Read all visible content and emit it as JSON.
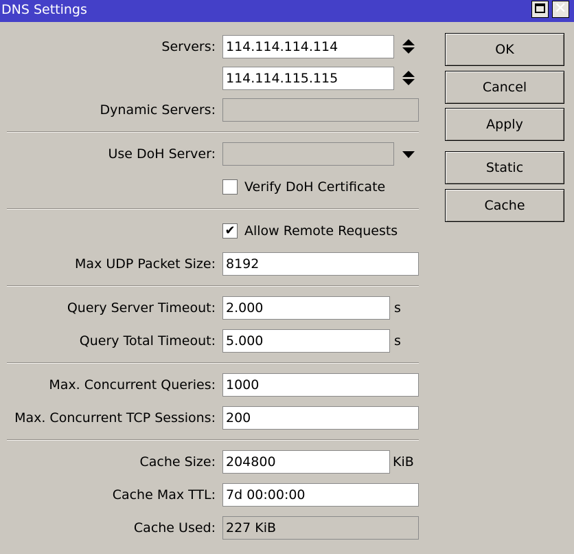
{
  "window": {
    "title": "DNS Settings"
  },
  "servers": {
    "label": "Servers:",
    "values": [
      "114.114.114.114",
      "114.114.115.115"
    ]
  },
  "dynamic_servers": {
    "label": "Dynamic Servers:",
    "value": ""
  },
  "doh": {
    "server_label": "Use DoH Server:",
    "server_value": "",
    "verify_label": "Verify DoH Certificate",
    "verify_checked": false
  },
  "remote": {
    "label": "Allow Remote Requests",
    "checked": true,
    "check_glyph": "✔"
  },
  "udp": {
    "label": "Max UDP Packet Size:",
    "value": "8192"
  },
  "timeouts": {
    "server_label": "Query Server Timeout:",
    "server_value": "2.000",
    "server_unit": "s",
    "total_label": "Query Total Timeout:",
    "total_value": "5.000",
    "total_unit": "s"
  },
  "concurrency": {
    "queries_label": "Max. Concurrent Queries:",
    "queries_value": "1000",
    "tcp_label": "Max. Concurrent TCP Sessions:",
    "tcp_value": "200"
  },
  "cache": {
    "size_label": "Cache Size:",
    "size_value": "204800",
    "size_unit": "KiB",
    "ttl_label": "Cache Max TTL:",
    "ttl_value": "7d 00:00:00",
    "used_label": "Cache Used:",
    "used_value": "227 KiB"
  },
  "buttons": {
    "ok": "OK",
    "cancel": "Cancel",
    "apply": "Apply",
    "static": "Static",
    "cache": "Cache"
  },
  "colors": {
    "titlebar": "#4440c8",
    "background": "#cbc7bf"
  }
}
